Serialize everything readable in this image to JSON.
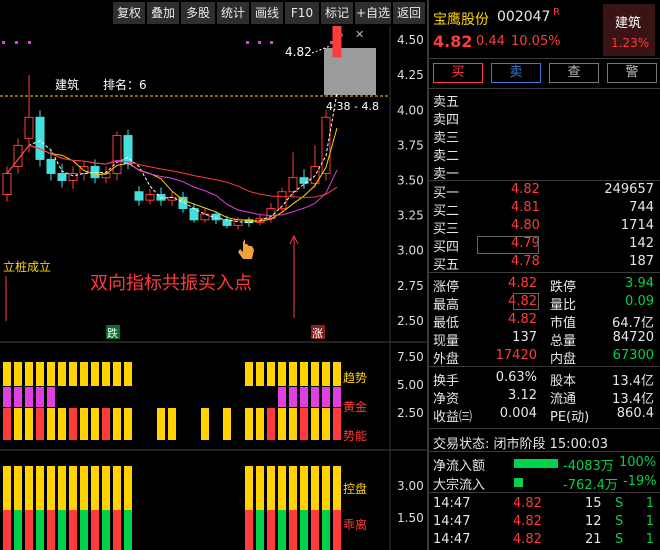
{
  "toolbar": {
    "buttons": [
      "复权",
      "叠加",
      "多股",
      "统计",
      "画线",
      "F10",
      "标记",
      "+自选",
      "返回"
    ]
  },
  "chart": {
    "price_callout": "4.82",
    "box_label": "4.38 - 4.8",
    "sector_label": "建筑",
    "rank_label": "排名：6",
    "annotation_left": "立桩成立",
    "annotation_main": "双向指标共振买入点",
    "tag_down": "跌",
    "tag_up": "涨",
    "y_ticks": [
      "4.50",
      "4.25",
      "4.00",
      "3.75",
      "3.50",
      "3.25",
      "3.00",
      "2.75",
      "2.50"
    ],
    "ind1_ticks": [
      "7.50",
      "5.00",
      "2.50"
    ],
    "ind1_labels": [
      "趋势",
      "黄金",
      "势能"
    ],
    "ind2_ticks": [
      "3.00",
      "1.50"
    ],
    "ind2_labels": [
      "控盘",
      "乖离"
    ]
  },
  "chart_data": {
    "type": "candlestick",
    "ylim": [
      2.35,
      4.6
    ],
    "candles": [
      {
        "o": 3.4,
        "c": 3.55,
        "h": 3.6,
        "l": 3.35
      },
      {
        "o": 3.6,
        "c": 3.75,
        "h": 3.8,
        "l": 3.55
      },
      {
        "o": 3.8,
        "c": 3.95,
        "h": 4.25,
        "l": 3.7
      },
      {
        "o": 3.95,
        "c": 3.65,
        "h": 4.0,
        "l": 3.6
      },
      {
        "o": 3.65,
        "c": 3.55,
        "h": 3.72,
        "l": 3.5
      },
      {
        "o": 3.55,
        "c": 3.5,
        "h": 3.62,
        "l": 3.45
      },
      {
        "o": 3.5,
        "c": 3.55,
        "h": 3.6,
        "l": 3.44
      },
      {
        "o": 3.55,
        "c": 3.6,
        "h": 3.63,
        "l": 3.5
      },
      {
        "o": 3.6,
        "c": 3.52,
        "h": 3.65,
        "l": 3.48
      },
      {
        "o": 3.52,
        "c": 3.55,
        "h": 3.6,
        "l": 3.48
      },
      {
        "o": 3.55,
        "c": 3.82,
        "h": 3.85,
        "l": 3.5
      },
      {
        "o": 3.82,
        "c": 3.62,
        "h": 3.86,
        "l": 3.58
      },
      {
        "o": 3.42,
        "c": 3.36,
        "h": 3.46,
        "l": 3.32
      },
      {
        "o": 3.36,
        "c": 3.4,
        "h": 3.44,
        "l": 3.33
      },
      {
        "o": 3.4,
        "c": 3.36,
        "h": 3.45,
        "l": 3.32
      },
      {
        "o": 3.36,
        "c": 3.38,
        "h": 3.42,
        "l": 3.32
      },
      {
        "o": 3.38,
        "c": 3.3,
        "h": 3.42,
        "l": 3.27
      },
      {
        "o": 3.3,
        "c": 3.22,
        "h": 3.33,
        "l": 3.2
      },
      {
        "o": 3.22,
        "c": 3.26,
        "h": 3.3,
        "l": 3.2
      },
      {
        "o": 3.26,
        "c": 3.22,
        "h": 3.28,
        "l": 3.19
      },
      {
        "o": 3.22,
        "c": 3.18,
        "h": 3.25,
        "l": 3.16
      },
      {
        "o": 3.18,
        "c": 3.22,
        "h": 3.24,
        "l": 3.15
      },
      {
        "o": 3.22,
        "c": 3.2,
        "h": 3.24,
        "l": 3.17
      },
      {
        "o": 3.2,
        "c": 3.23,
        "h": 3.26,
        "l": 3.18
      },
      {
        "o": 3.23,
        "c": 3.3,
        "h": 3.34,
        "l": 3.2
      },
      {
        "o": 3.3,
        "c": 3.42,
        "h": 3.45,
        "l": 3.28
      },
      {
        "o": 3.42,
        "c": 3.52,
        "h": 3.7,
        "l": 3.38
      },
      {
        "o": 3.52,
        "c": 3.48,
        "h": 3.58,
        "l": 3.44
      },
      {
        "o": 3.48,
        "c": 3.6,
        "h": 3.75,
        "l": 3.45
      },
      {
        "o": 3.55,
        "c": 3.95,
        "h": 4.0,
        "l": 3.5
      },
      {
        "o": 4.38,
        "c": 4.82,
        "h": 4.82,
        "l": 4.38
      }
    ]
  },
  "quote": {
    "name": "宝鹰股份",
    "code": "002047",
    "flag": "R",
    "price": "4.82",
    "change": "0.44",
    "change_pct": "10.05%",
    "sector_name": "建筑",
    "sector_pct": "1.23%",
    "actions": [
      "买",
      "卖",
      "查",
      "警"
    ],
    "sell_levels": [
      "卖五",
      "卖四",
      "卖三",
      "卖二",
      "卖一"
    ],
    "buy_levels": [
      {
        "label": "买一",
        "price": "4.82",
        "vol": "249657"
      },
      {
        "label": "买二",
        "price": "4.81",
        "vol": "744"
      },
      {
        "label": "买三",
        "price": "4.80",
        "vol": "1714"
      },
      {
        "label": "买四",
        "price": "4.79",
        "vol": "142"
      },
      {
        "label": "买五",
        "price": "4.78",
        "vol": "187"
      }
    ],
    "stats": {
      "zhangting_l": "涨停",
      "zhangting_v": "4.82",
      "dieting_l": "跌停",
      "dieting_v": "3.94",
      "zuigao_l": "最高",
      "zuigao_v": "4.82",
      "liangbi_l": "量比",
      "liangbi_v": "0.09",
      "zuidi_l": "最低",
      "zuidi_v": "4.82",
      "shizhi_l": "市值",
      "shizhi_v": "64.7亿",
      "xianliang_l": "现量",
      "xianliang_v": "137",
      "zongliang_l": "总量",
      "zongliang_v": "84720",
      "waipan_l": "外盘",
      "waipan_v": "17420",
      "neipan_l": "内盘",
      "neipan_v": "67300",
      "huanshou_l": "换手",
      "huanshou_v": "0.63%",
      "guben_l": "股本",
      "guben_v": "13.4亿",
      "jingzi_l": "净资",
      "jingzi_v": "3.12",
      "liutong_l": "流通",
      "liutong_v": "13.4亿",
      "shouyi_l": "收益㈢",
      "shouyi_v": "0.004",
      "pe_l": "PE(动)",
      "pe_v": "860.4"
    },
    "trade_status": "交易状态: 闭市阶段 15:00:03",
    "net_inflow_label": "净流入额",
    "net_inflow_value": "-4083万",
    "net_inflow_pct": "100%",
    "block_label": "大宗流入",
    "block_value": "-762.4万",
    "block_pct": "-19%",
    "ticks": [
      {
        "time": "14:47",
        "price": "4.82",
        "vol": "15",
        "side": "S",
        "n": "1"
      },
      {
        "time": "14:47",
        "price": "4.82",
        "vol": "12",
        "side": "S",
        "n": "1"
      },
      {
        "time": "14:47",
        "price": "4.82",
        "vol": "21",
        "side": "S",
        "n": "1"
      }
    ]
  }
}
